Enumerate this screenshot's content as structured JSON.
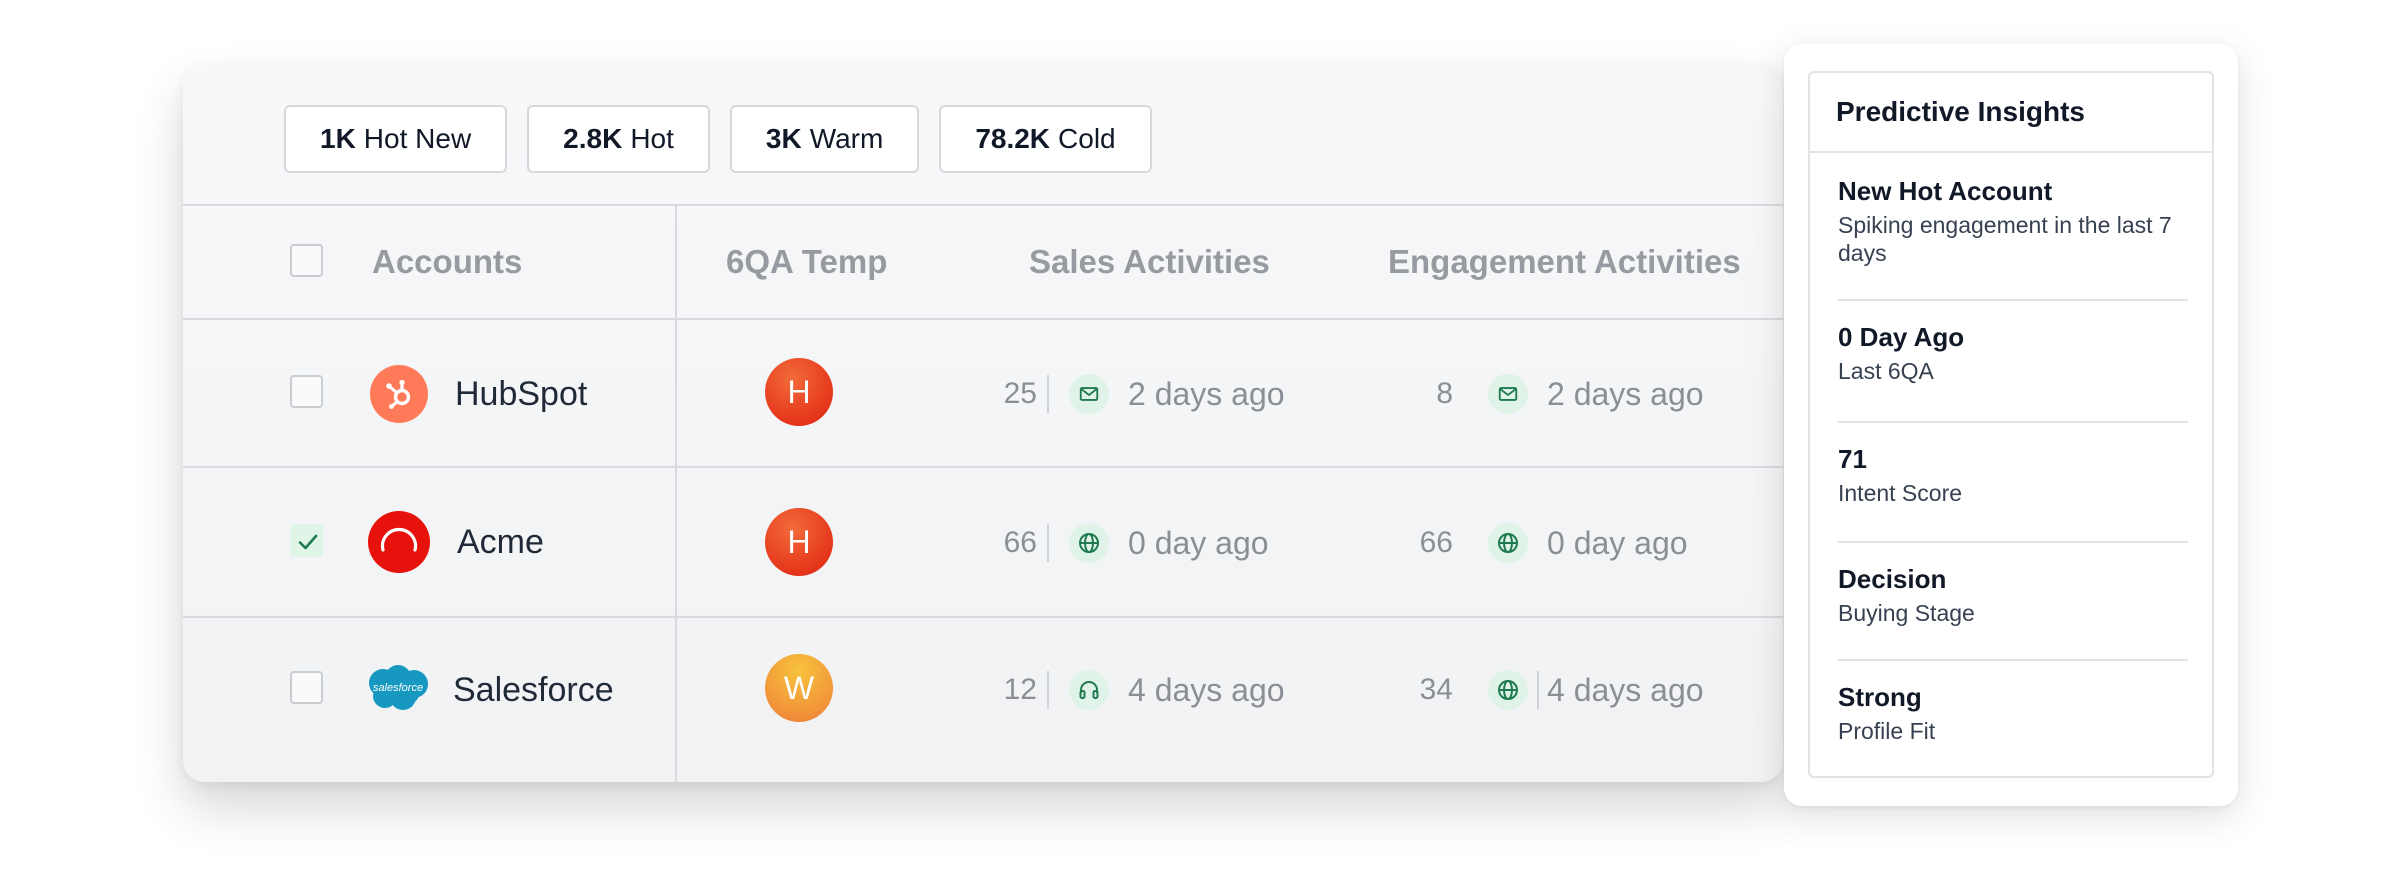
{
  "filters": [
    {
      "count": "1K",
      "label": "Hot New"
    },
    {
      "count": "2.8K",
      "label": "Hot"
    },
    {
      "count": "3K",
      "label": "Warm"
    },
    {
      "count": "78.2K",
      "label": "Cold"
    }
  ],
  "table": {
    "columns": [
      "Accounts",
      "6QA Temp",
      "Sales Activities",
      "Engagement Activities"
    ],
    "rows": [
      {
        "name": "HubSpot",
        "logo": "hubspot-logo",
        "checked": false,
        "temp": "H",
        "sales_count": "25",
        "sales_icon": "mail-icon",
        "sales_time": "2 days ago",
        "eng_count": "8",
        "eng_icon": "mail-icon",
        "eng_time": "2 days ago"
      },
      {
        "name": "Acme",
        "logo": "acme-logo",
        "checked": true,
        "temp": "H",
        "sales_count": "66",
        "sales_icon": "globe-icon",
        "sales_time": "0 day ago",
        "eng_count": "66",
        "eng_icon": "globe-icon",
        "eng_time": "0 day ago"
      },
      {
        "name": "Salesforce",
        "logo": "salesforce-logo",
        "logo_text": "salesforce",
        "checked": false,
        "temp": "W",
        "sales_count": "12",
        "sales_icon": "headset-icon",
        "sales_time": "4 days ago",
        "eng_count": "34",
        "eng_icon": "globe-icon",
        "eng_time": "4 days ago"
      }
    ]
  },
  "insights": {
    "title": "Predictive Insights",
    "items": [
      {
        "key": "New Hot Account",
        "value": "Spiking engagement in the last 7 days"
      },
      {
        "key": "0 Day Ago",
        "value": "Last 6QA"
      },
      {
        "key": "71",
        "value": "Intent Score"
      },
      {
        "key": "Decision",
        "value": "Buying Stage"
      },
      {
        "key": "Strong",
        "value": "Profile Fit"
      }
    ]
  },
  "colors": {
    "hot": "#e5361b",
    "warm": "#f29a3a",
    "accent_green": "#1f7a4d",
    "icon_bg": "#e0f3e8",
    "hubspot": "#ff7a59",
    "acme": "#e8120c",
    "salesforce": "#1798c1"
  }
}
